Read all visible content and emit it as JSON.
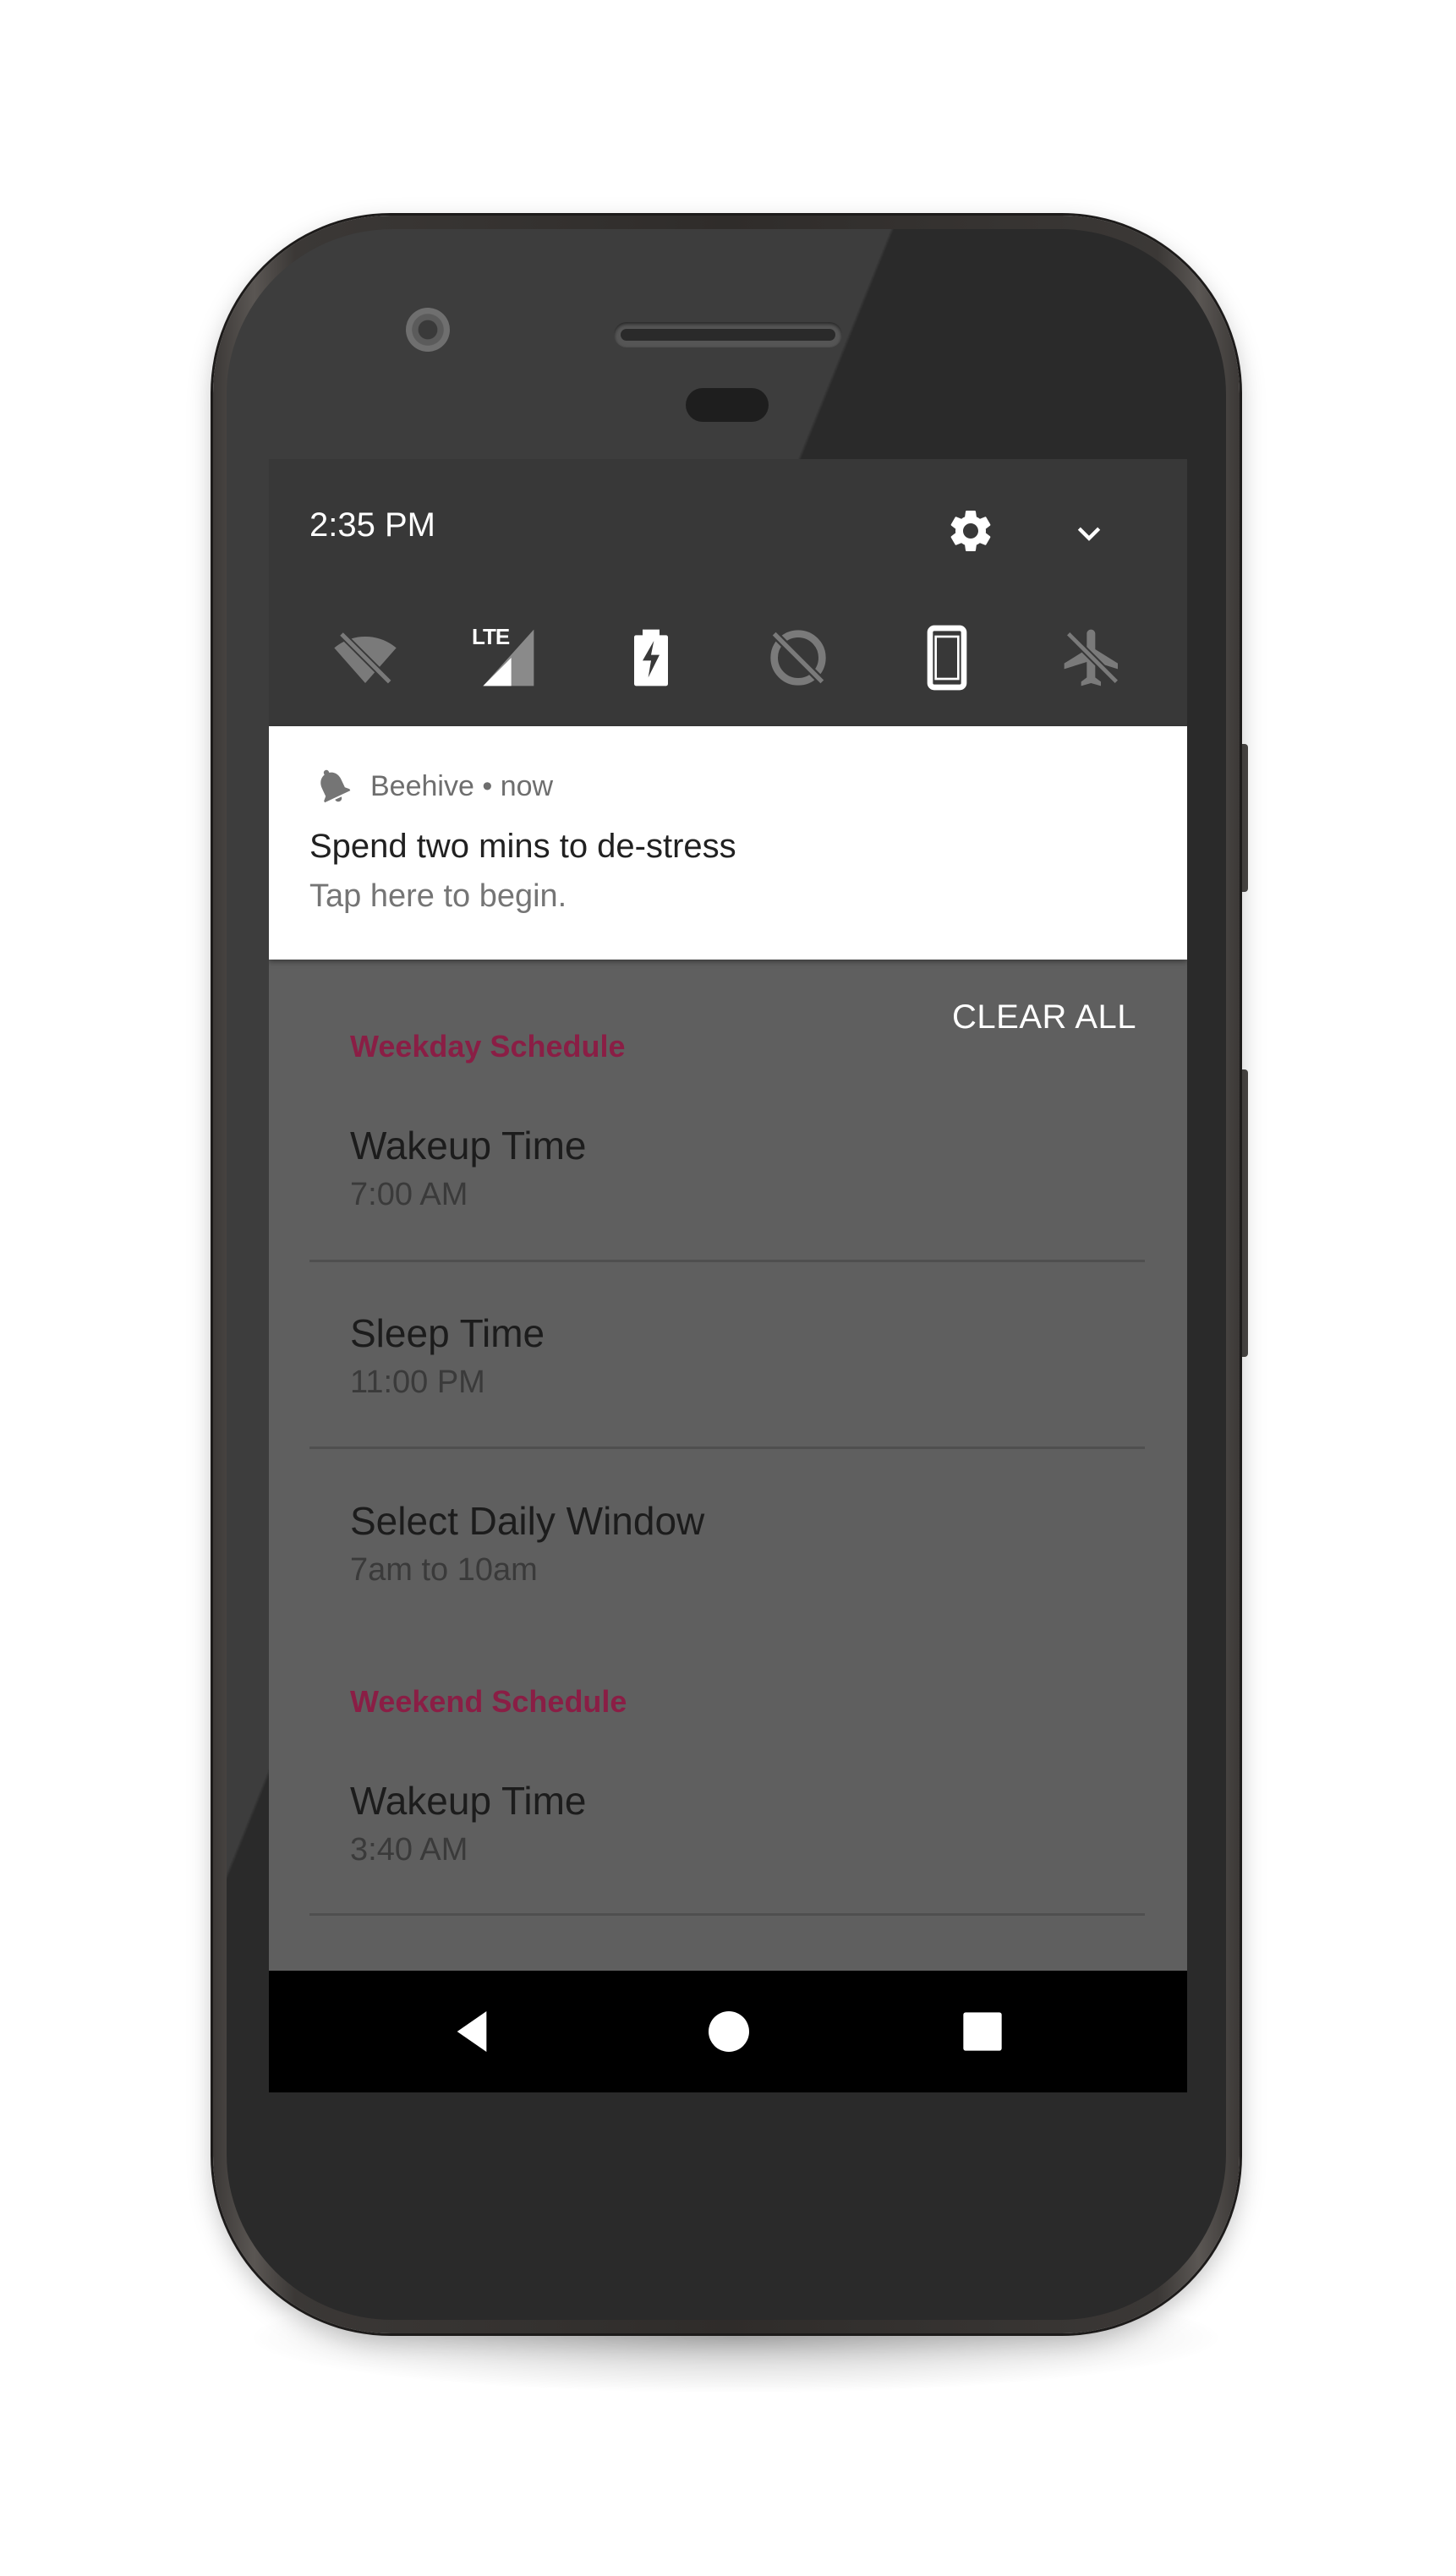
{
  "status_bar": {
    "time": "2:35 PM",
    "icons": [
      "settings-gear-icon",
      "expand-chevron-icon"
    ]
  },
  "quick_settings": {
    "tiles": [
      {
        "icon": "wifi-off-icon",
        "state": "off"
      },
      {
        "icon": "lte-signal-icon",
        "label": "LTE",
        "state": "on"
      },
      {
        "icon": "battery-saver-icon",
        "state": "on"
      },
      {
        "icon": "data-saver-off-icon",
        "state": "off"
      },
      {
        "icon": "phone-rotation-icon",
        "state": "on"
      },
      {
        "icon": "airplane-mode-off-icon",
        "state": "off"
      }
    ]
  },
  "notification": {
    "app_name": "Beehive",
    "separator": "•",
    "time": "now",
    "title": "Spend two mins to de-stress",
    "text": "Tap here to begin."
  },
  "clear_all_label": "CLEAR ALL",
  "weekday": {
    "header": "Weekday Schedule",
    "wakeup": {
      "title": "Wakeup Time",
      "summary": "7:00 AM"
    },
    "sleep": {
      "title": "Sleep Time",
      "summary": "11:00 PM"
    },
    "window": {
      "title": "Select Daily Window",
      "summary": "7am to 10am"
    }
  },
  "weekend": {
    "header": "Weekend Schedule",
    "wakeup": {
      "title": "Wakeup Time",
      "summary": "3:40 AM"
    }
  },
  "navigation": {
    "buttons": [
      "back-icon",
      "home-icon",
      "recents-icon"
    ]
  },
  "colors": {
    "accent": "#8a1e45",
    "screen_background": "#5f5f5f",
    "quick_settings_background": "#383838"
  }
}
